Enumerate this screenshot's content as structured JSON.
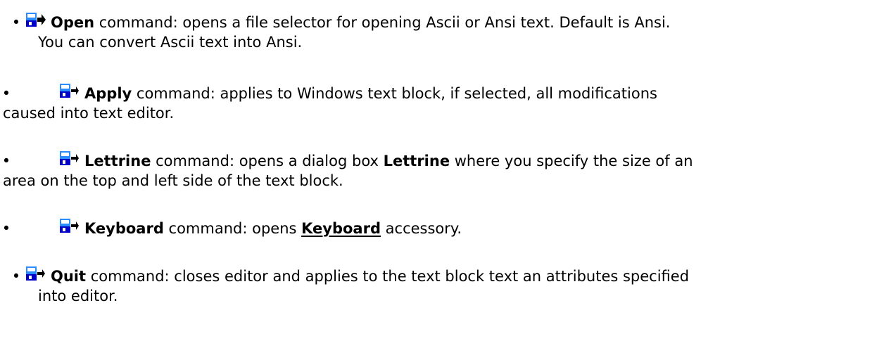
{
  "bullet": "•",
  "icon_name": "toolbar-button-icon",
  "items": [
    {
      "name": "Open",
      "line1": " command: opens a file selector for opening Ascii or Ansi text. Default is Ansi.",
      "line2": "You can convert Ascii text into Ansi."
    },
    {
      "name": "Apply",
      "line1": " command: applies to Windows text block, if selected, all modifications",
      "line2": "caused into text editor."
    },
    {
      "name": "Lettrine",
      "line1a": " command: opens a dialog box ",
      "dialog_name": "Lettrine",
      "line1b": " where you specify the size of an",
      "line2": "area on the top and left side of the text block."
    },
    {
      "name": "Keyboard",
      "line1a": " command: opens ",
      "link": "Keyboard",
      "line1b": " accessory."
    },
    {
      "name": "Quit",
      "line1": " command: closes editor and applies to the text block text an attributes specified",
      "line2": "into editor."
    }
  ]
}
